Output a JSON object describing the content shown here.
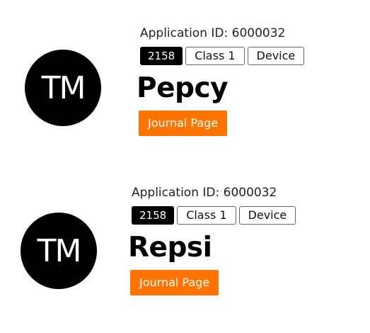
{
  "records": [
    {
      "avatar_initials": "TM",
      "application_id": "Application ID: 6000032",
      "chips": [
        "2158",
        "Class 1",
        "Device"
      ],
      "name": "Pepcy",
      "journal_button_label": "Journal Page"
    },
    {
      "avatar_initials": "TM",
      "application_id": "Application ID: 6000032",
      "chips": [
        "2158",
        "Class 1",
        "Device"
      ],
      "name": "Repsi",
      "journal_button_label": "Journal Page"
    }
  ],
  "colors": {
    "accent_button": "#ff7300",
    "avatar_bg": "#000000",
    "chip_dark_bg": "#000000"
  }
}
